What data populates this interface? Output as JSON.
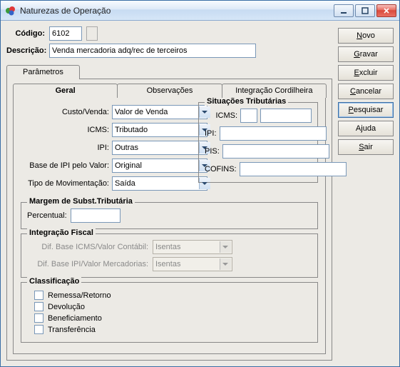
{
  "window": {
    "title": "Naturezas de Operação"
  },
  "header": {
    "codigo_label": "Código:",
    "codigo_value": "6102",
    "descricao_label": "Descrição:",
    "descricao_value": "Venda mercadoria adq/rec de terceiros"
  },
  "outer_tabs": {
    "parametros": "Parâmetros"
  },
  "inner_tabs": {
    "geral": "Geral",
    "observacoes": "Observações",
    "integracao": "Integração Cordilheira"
  },
  "geral": {
    "custo_venda_label": "Custo/Venda:",
    "custo_venda_value": "Valor de Venda",
    "icms_label": "ICMS:",
    "icms_value": "Tributado",
    "ipi_label": "IPI:",
    "ipi_value": "Outras",
    "base_ipi_label": "Base de IPI pelo Valor:",
    "base_ipi_value": "Original",
    "tipo_mov_label": "Tipo de Movimentação:",
    "tipo_mov_value": "Saída"
  },
  "situacoes": {
    "title": "Situações Tributárias",
    "icms_label": "ICMS:",
    "icms_a": "",
    "icms_b": "",
    "ipi_label": "IPI:",
    "ipi_value": "",
    "pis_label": "PIS:",
    "pis_value": "",
    "cofins_label": "COFINS:",
    "cofins_value": ""
  },
  "margem": {
    "title": "Margem de Subst.Tributária",
    "percentual_label": "Percentual:",
    "percentual_value": ""
  },
  "integracao_fiscal": {
    "title": "Integração Fiscal",
    "dif_icms_label": "Dif. Base ICMS/Valor Contábil:",
    "dif_icms_value": "Isentas",
    "dif_ipi_label": "Dif. Base IPI/Valor Mercadorias:",
    "dif_ipi_value": "Isentas"
  },
  "classificacao": {
    "title": "Classificação",
    "remessa": "Remessa/Retorno",
    "devolucao": "Devolução",
    "beneficiamento": "Beneficiamento",
    "transferencia": "Transferência"
  },
  "buttons": {
    "novo": "Novo",
    "gravar": "Gravar",
    "excluir": "Excluir",
    "cancelar": "Cancelar",
    "pesquisar": "Pesquisar",
    "ajuda": "Ajuda",
    "sair": "Sair"
  }
}
